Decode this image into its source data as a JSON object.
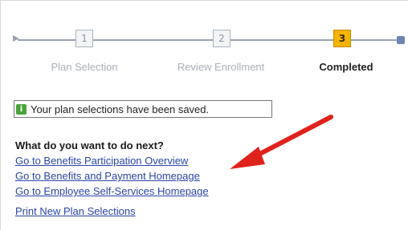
{
  "stepper": {
    "steps": [
      {
        "number": "1",
        "label": "Plan Selection",
        "state": "done"
      },
      {
        "number": "2",
        "label": "Review Enrollment",
        "state": "done"
      },
      {
        "number": "3",
        "label": "Completed",
        "state": "current"
      }
    ]
  },
  "message": {
    "icon": "info-icon",
    "text": "Your plan selections have been saved."
  },
  "next_steps": {
    "heading": "What do you want to do next?",
    "links": [
      "Go to Benefits Participation Overview",
      "Go to Benefits and Payment Homepage",
      "Go to Employee Self-Services Homepage"
    ],
    "print_link": "Print New Plan Selections"
  },
  "colors": {
    "link": "#2945a8",
    "current_step": "#f4b400",
    "annotation_arrow": "#e0221c",
    "info_icon": "#4aa33c"
  }
}
